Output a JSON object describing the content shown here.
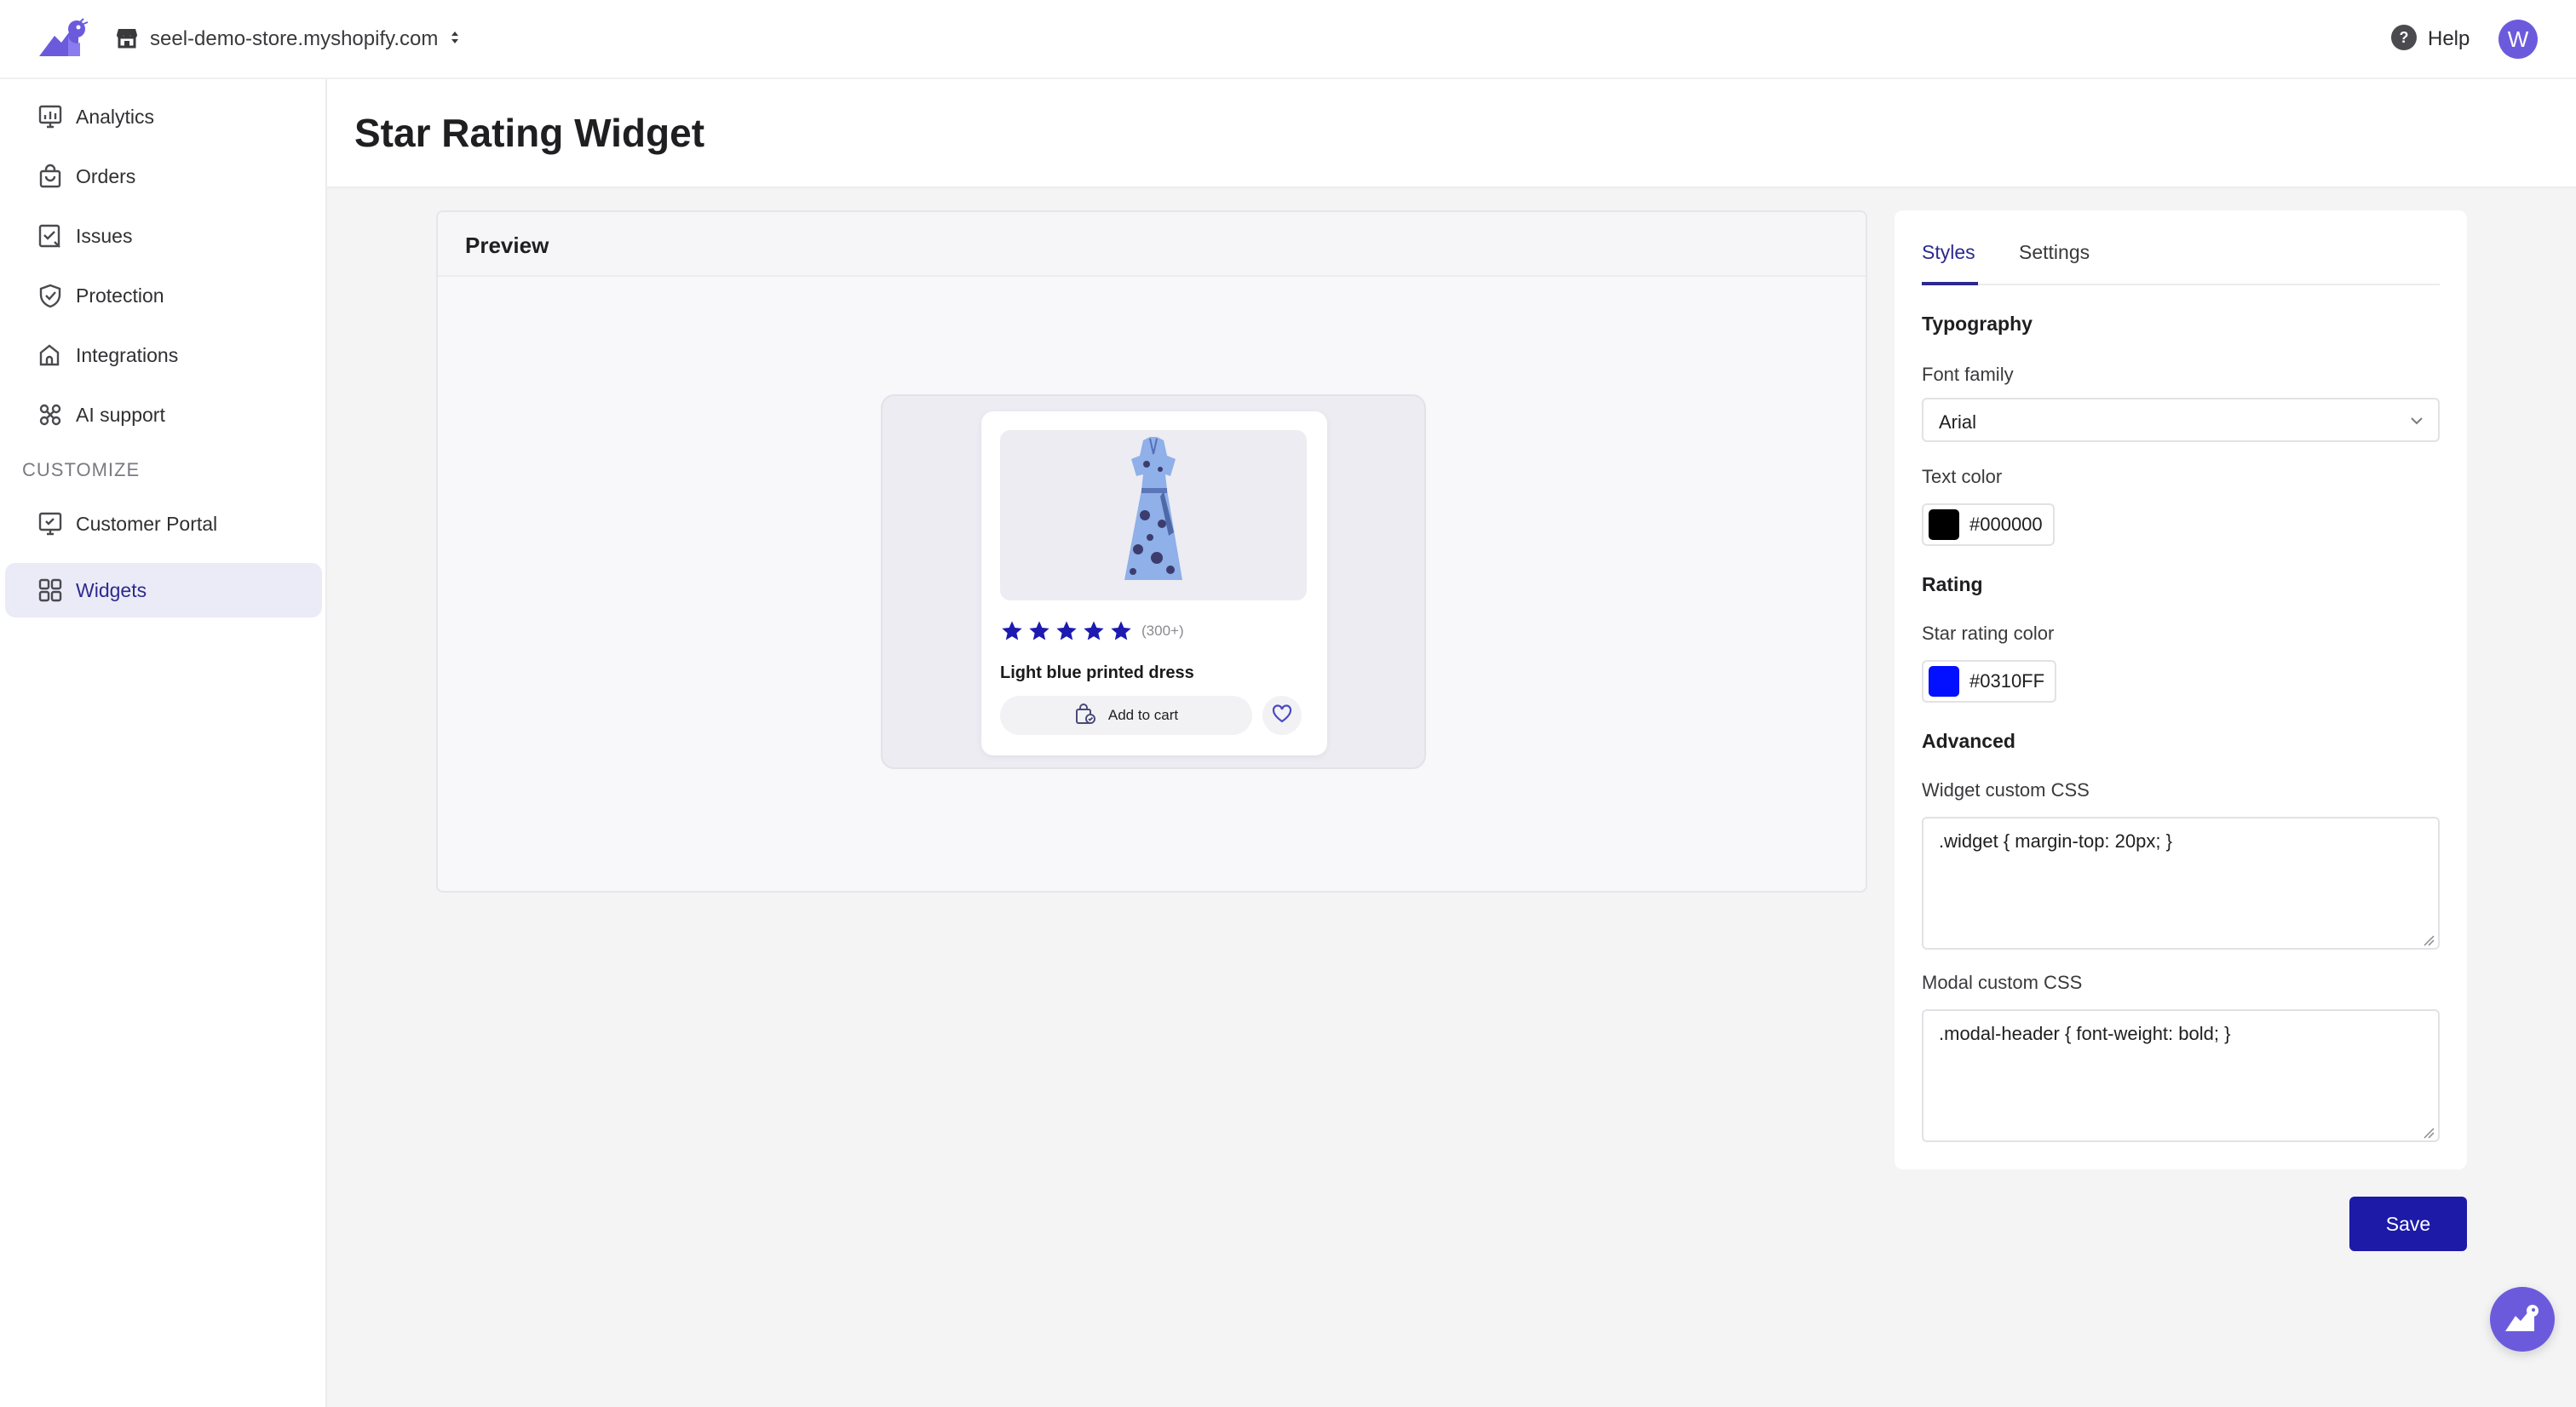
{
  "app": {
    "store_name": "seel-demo-store.myshopify.com",
    "help_label": "Help",
    "avatar_initial": "W",
    "brand_color": "#6b5bdc"
  },
  "sidebar": {
    "items": [
      {
        "label": "Analytics",
        "icon": "analytics-icon"
      },
      {
        "label": "Orders",
        "icon": "orders-bag-icon"
      },
      {
        "label": "Issues",
        "icon": "issues-icon"
      },
      {
        "label": "Protection",
        "icon": "shield-check-icon"
      },
      {
        "label": "Integrations",
        "icon": "puzzle-icon"
      },
      {
        "label": "AI support",
        "icon": "ai-support-icon"
      }
    ],
    "section_label": "CUSTOMIZE",
    "custom_items": [
      {
        "label": "Customer Portal",
        "icon": "monitor-icon"
      },
      {
        "label": "Widgets",
        "icon": "widgets-grid-icon",
        "active": true
      }
    ]
  },
  "page": {
    "title": "Star Rating Widget"
  },
  "preview": {
    "title": "Preview",
    "product": {
      "name": "Light blue printed dress",
      "review_count": "(300+)",
      "add_to_cart_label": "Add to cart",
      "rating": 5,
      "max_rating": 5
    }
  },
  "settings": {
    "tabs": {
      "styles": "Styles",
      "settings": "Settings",
      "active": "Styles"
    },
    "typography_title": "Typography",
    "font_family_label": "Font family",
    "font_family_value": "Arial",
    "text_color_label": "Text color",
    "text_color_value": "#000000",
    "rating_title": "Rating",
    "star_color_label": "Star rating color",
    "star_color_value": "#0310FF",
    "advanced_title": "Advanced",
    "widget_css_label": "Widget custom CSS",
    "widget_css_value": ".widget { margin-top: 20px; }",
    "modal_css_label": "Modal custom CSS",
    "modal_css_value": ".modal-header { font-weight: bold; }"
  },
  "actions": {
    "save_label": "Save",
    "save_color": "#1d1aa8",
    "star_display_color": "#1c1ab0"
  }
}
